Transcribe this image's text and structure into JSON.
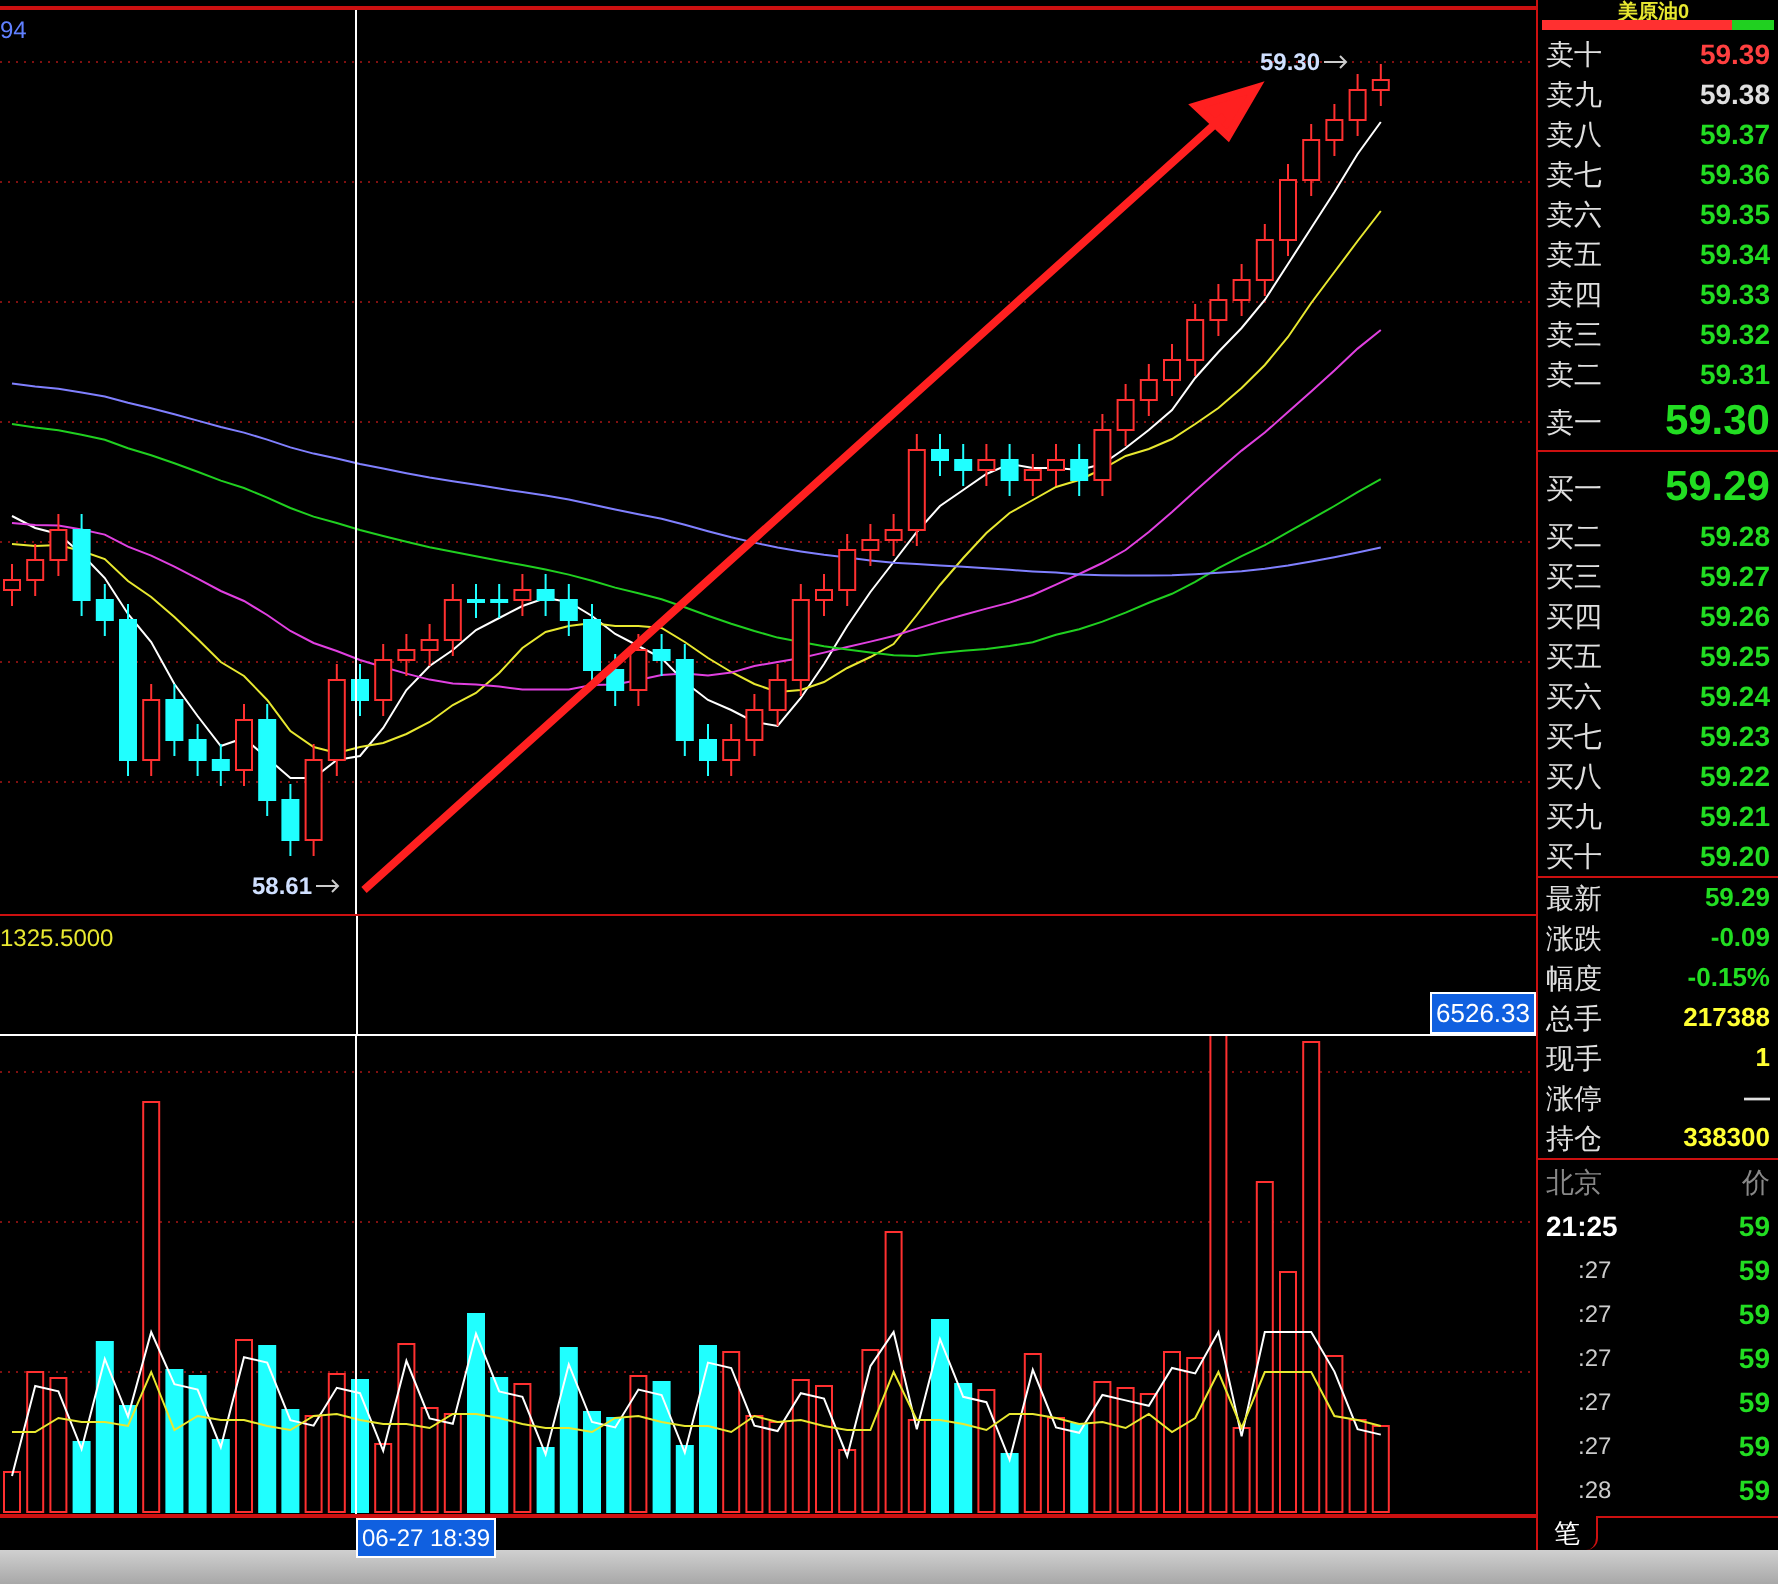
{
  "chart": {
    "corner_label": "94",
    "high_label": "59.30",
    "low_label": "58.61",
    "indicator_label": "1325.5000",
    "volume_value": "6526.33",
    "cursor_time": "06-27 18:39"
  },
  "quote": {
    "title": "美原油0",
    "ratio_bar": {
      "level": 0.82
    },
    "asks": [
      {
        "label": "卖十",
        "price": "59.39",
        "color": "#ff4040"
      },
      {
        "label": "卖九",
        "price": "59.38",
        "color": "#e0e0e0"
      },
      {
        "label": "卖八",
        "price": "59.37",
        "color": "#22dd22"
      },
      {
        "label": "卖七",
        "price": "59.36",
        "color": "#22dd22"
      },
      {
        "label": "卖六",
        "price": "59.35",
        "color": "#22dd22"
      },
      {
        "label": "卖五",
        "price": "59.34",
        "color": "#22dd22"
      },
      {
        "label": "卖四",
        "price": "59.33",
        "color": "#22dd22"
      },
      {
        "label": "卖三",
        "price": "59.32",
        "color": "#22dd22"
      },
      {
        "label": "卖二",
        "price": "59.31",
        "color": "#22dd22"
      },
      {
        "label": "卖一",
        "price": "59.30",
        "color": "#22dd22"
      }
    ],
    "bids": [
      {
        "label": "买一",
        "price": "59.29",
        "color": "#22dd22"
      },
      {
        "label": "买二",
        "price": "59.28",
        "color": "#22dd22"
      },
      {
        "label": "买三",
        "price": "59.27",
        "color": "#22dd22"
      },
      {
        "label": "买四",
        "price": "59.26",
        "color": "#22dd22"
      },
      {
        "label": "买五",
        "price": "59.25",
        "color": "#22dd22"
      },
      {
        "label": "买六",
        "price": "59.24",
        "color": "#22dd22"
      },
      {
        "label": "买七",
        "price": "59.23",
        "color": "#22dd22"
      },
      {
        "label": "买八",
        "price": "59.22",
        "color": "#22dd22"
      },
      {
        "label": "买九",
        "price": "59.21",
        "color": "#22dd22"
      },
      {
        "label": "买十",
        "price": "59.20",
        "color": "#22dd22"
      }
    ],
    "stats": [
      {
        "label": "最新",
        "value": "59.29",
        "color": "#22dd22"
      },
      {
        "label": "涨跌",
        "value": "-0.09",
        "color": "#22dd22"
      },
      {
        "label": "幅度",
        "value": "-0.15%",
        "color": "#22dd22"
      },
      {
        "label": "总手",
        "value": "217388",
        "color": "#ffff33"
      },
      {
        "label": "现手",
        "value": "1",
        "color": "#ffff33"
      },
      {
        "label": "涨停",
        "value": "—",
        "color": "#e0e0e0"
      },
      {
        "label": "持仓",
        "value": "338300",
        "color": "#ffff33"
      }
    ],
    "ticks_header": {
      "time": "北京",
      "price": "价"
    },
    "ticks": [
      {
        "time": "21:25",
        "price": "59"
      },
      {
        "time": ":27",
        "price": "59"
      },
      {
        "time": ":27",
        "price": "59"
      },
      {
        "time": ":27",
        "price": "59"
      },
      {
        "time": ":27",
        "price": "59"
      },
      {
        "time": ":27",
        "price": "59"
      },
      {
        "time": ":28",
        "price": "59"
      }
    ],
    "tabs": [
      {
        "label": "笔",
        "selected": true
      }
    ]
  }
}
